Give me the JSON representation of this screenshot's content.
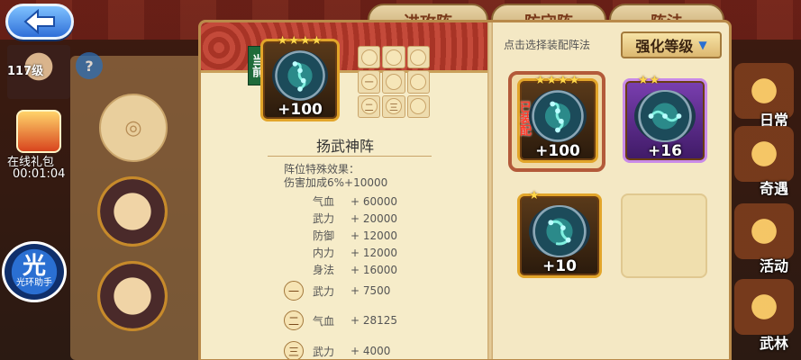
{
  "top_tabs": [
    "进攻阵",
    "防守阵",
    "阵法"
  ],
  "player": {
    "level_text": "117级",
    "name_fragment": ""
  },
  "left_menu": {
    "gift_label": "在线礼包",
    "gift_timer": "00:01:04"
  },
  "help_badge": "?",
  "assistant": {
    "big": "光",
    "small": "光环助手"
  },
  "right_menu": [
    {
      "label": "日常"
    },
    {
      "label": "奇遇"
    },
    {
      "label": "活动"
    },
    {
      "label": "武林"
    }
  ],
  "current_formation": {
    "current_tag": "当前",
    "stars": "★★★★",
    "value": "+100",
    "name": "扬武神阵",
    "grid": [
      "",
      "",
      "",
      "一",
      "",
      "",
      "二",
      "三",
      ""
    ]
  },
  "effect": {
    "title": "阵位特殊效果：",
    "desc": "伤害加成6%+10000"
  },
  "stats": [
    {
      "k": "气血",
      "v": "+ 60000"
    },
    {
      "k": "武力",
      "v": "+ 20000"
    },
    {
      "k": "防御",
      "v": "+ 12000"
    },
    {
      "k": "内力",
      "v": "+ 12000"
    },
    {
      "k": "身法",
      "v": "+ 16000"
    }
  ],
  "positions": [
    {
      "n": "一",
      "k": "武力",
      "v": "+ 7500"
    },
    {
      "n": "二",
      "k": "气血",
      "v": "+ 28125"
    },
    {
      "n": "三",
      "k": "武力",
      "v": "+ 4000"
    }
  ],
  "right_panel": {
    "hint": "点击选择装配阵法",
    "sort_label": "强化等级",
    "items": [
      {
        "stars": "★★★★",
        "value": "+100",
        "equipped": "已装配"
      },
      {
        "stars": "★★",
        "value": "+16"
      },
      {
        "stars": "★",
        "value": "+10"
      }
    ]
  },
  "colors": {
    "accent_gold": "#e2a52a",
    "purple_rare": "#7a3fb0",
    "equipped_red": "#ff3b2a"
  }
}
